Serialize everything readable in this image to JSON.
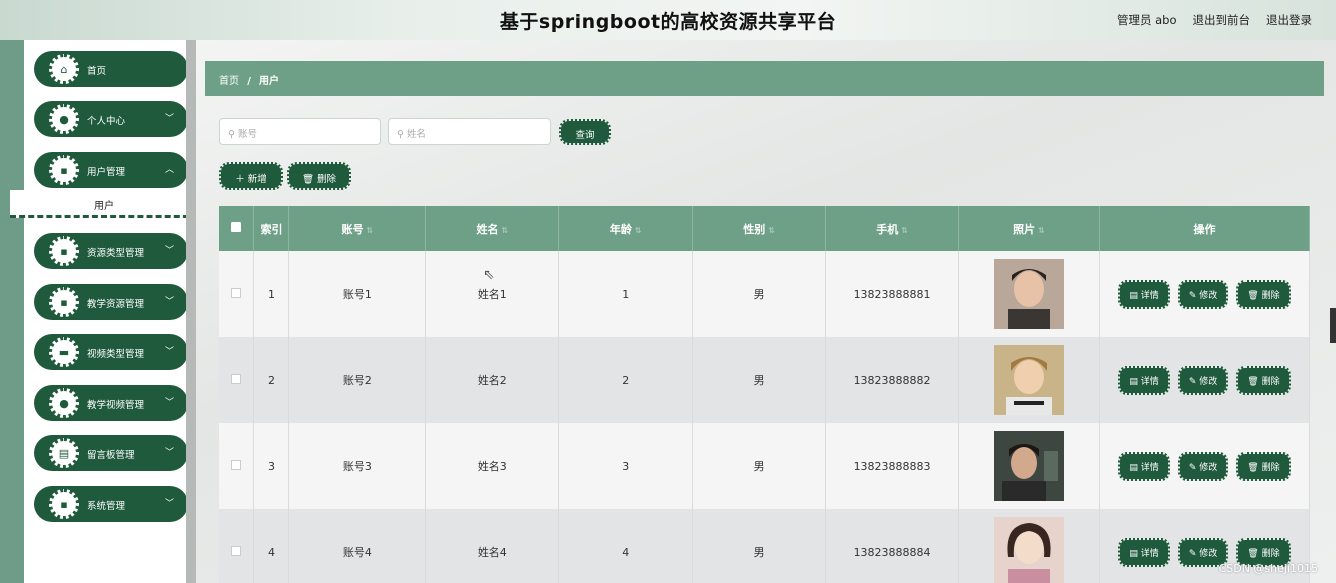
{
  "header": {
    "title": "基于springboot的高校资源共享平台",
    "user": "管理员 abo",
    "to_front": "退出到前台",
    "logout": "退出登录"
  },
  "sidebar": {
    "items": [
      {
        "label": "首页",
        "icon": "home-icon",
        "has_children": false
      },
      {
        "label": "个人中心",
        "icon": "user-icon",
        "has_children": true
      },
      {
        "label": "用户管理",
        "icon": "grid-icon",
        "has_children": true
      },
      {
        "label": "资源类型管理",
        "icon": "grid-icon",
        "has_children": true
      },
      {
        "label": "教学资源管理",
        "icon": "grid-icon",
        "has_children": true
      },
      {
        "label": "视频类型管理",
        "icon": "monitor-icon",
        "has_children": true
      },
      {
        "label": "教学视频管理",
        "icon": "user-icon",
        "has_children": true
      },
      {
        "label": "留言板管理",
        "icon": "doc-icon",
        "has_children": true
      },
      {
        "label": "系统管理",
        "icon": "grid-icon",
        "has_children": true
      }
    ],
    "submenu_active": "用户"
  },
  "breadcrumb": {
    "home": "首页",
    "sep": "/",
    "current": "用户"
  },
  "search": {
    "account_placeholder": "账号",
    "name_placeholder": "姓名",
    "query_label": "查询"
  },
  "actions": {
    "add_label": "新增",
    "delete_label": "删除"
  },
  "table": {
    "headers": [
      "索引",
      "账号",
      "姓名",
      "年龄",
      "性别",
      "手机",
      "照片",
      "操作"
    ],
    "rows": [
      {
        "index": "1",
        "account": "账号1",
        "name": "姓名1",
        "age": "1",
        "gender": "男",
        "phone": "13823888881"
      },
      {
        "index": "2",
        "account": "账号2",
        "name": "姓名2",
        "age": "2",
        "gender": "男",
        "phone": "13823888882"
      },
      {
        "index": "3",
        "account": "账号3",
        "name": "姓名3",
        "age": "3",
        "gender": "男",
        "phone": "13823888883"
      },
      {
        "index": "4",
        "account": "账号4",
        "name": "姓名4",
        "age": "4",
        "gender": "男",
        "phone": "13823888884"
      }
    ],
    "op_detail": "详情",
    "op_edit": "修改",
    "op_delete": "删除"
  },
  "watermark": "CSDN @shejì1015",
  "colors": {
    "primary": "#1f5a3c",
    "accent": "#6ea088"
  }
}
